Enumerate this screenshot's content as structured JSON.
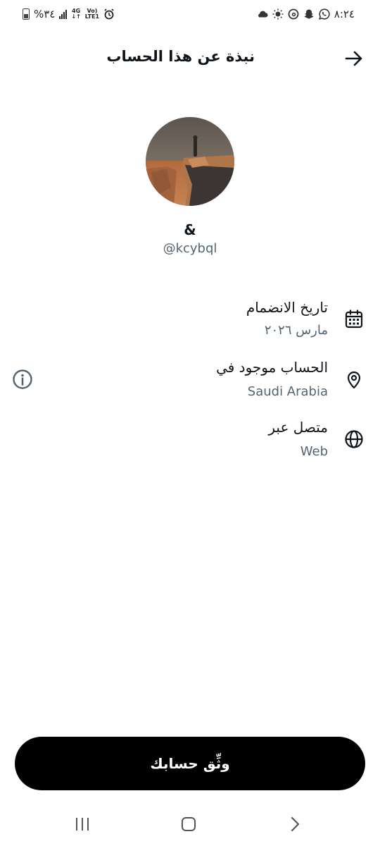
{
  "status_bar": {
    "battery_text": "%٣٤",
    "net_4g_top": "4G",
    "net_4g_bottom": "↓↑",
    "volte_top": "Vo)",
    "volte_bottom": "LTE1",
    "time": "٨:٢٤",
    "left_icons": [
      "battery-icon",
      "signal-icon",
      "alarm-icon"
    ],
    "right_icons": [
      "cloud-icon",
      "brightness-icon",
      "threads-icon",
      "snapchat-icon",
      "whatsapp-icon"
    ]
  },
  "header": {
    "title": "نبذة عن هذا الحساب",
    "back_icon": "arrow-right-icon"
  },
  "profile": {
    "display_name": "&",
    "handle": "@kcybql",
    "avatar_alt": "profile-photo"
  },
  "info_rows": [
    {
      "icon": "calendar-icon",
      "label": "تاريخ الانضمام",
      "value": "مارس ٢٠٢٦"
    },
    {
      "icon": "location-pin-icon",
      "label": "الحساب موجود في",
      "value": "Saudi Arabia"
    },
    {
      "icon": "globe-icon",
      "label": "متصل عبر",
      "value": "Web"
    }
  ],
  "verify_button": {
    "label": "وثِّق حسابك"
  },
  "nav": {
    "items": [
      "recents-icon",
      "home-icon",
      "back-chevron-icon"
    ]
  },
  "colors": {
    "text": "#0f1419",
    "secondary": "#536471",
    "button_bg": "#000000",
    "button_text": "#ffffff"
  }
}
